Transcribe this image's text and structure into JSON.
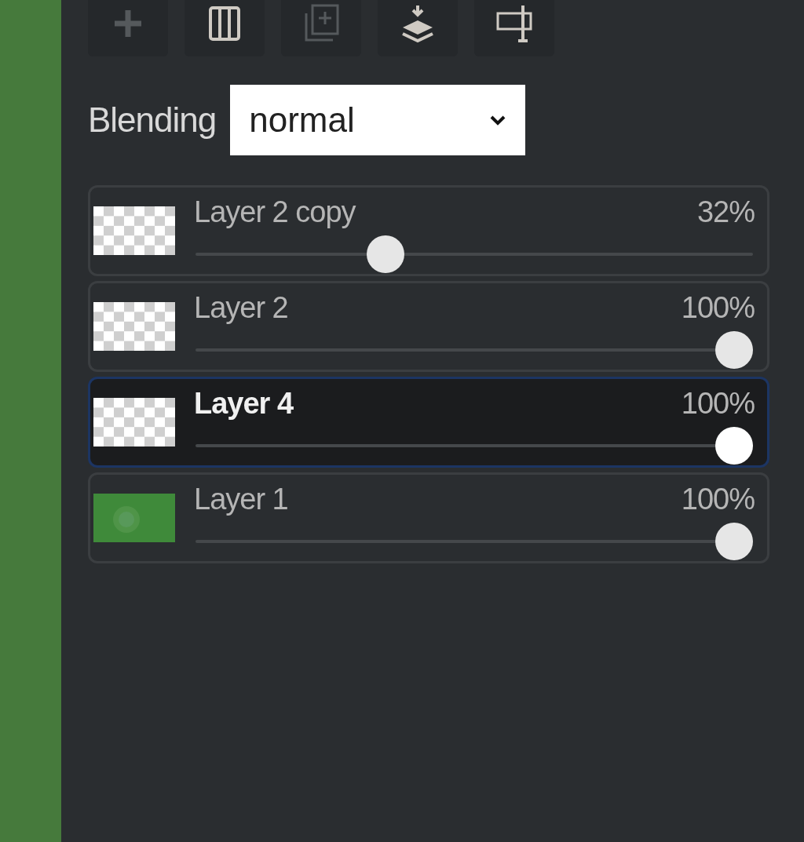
{
  "toolbar": [
    {
      "kind": "add",
      "disabled": true
    },
    {
      "kind": "columns",
      "disabled": false
    },
    {
      "kind": "duplicate",
      "disabled": true
    },
    {
      "kind": "merge",
      "disabled": false
    },
    {
      "kind": "resize",
      "disabled": false
    }
  ],
  "blending": {
    "label": "Blending",
    "value": "normal"
  },
  "layers": [
    {
      "name": "Layer 2 copy",
      "opacity": "32%",
      "level": 0.33,
      "selected": false,
      "kind": "transparent"
    },
    {
      "name": "Layer 2",
      "opacity": "100%",
      "level": 1,
      "selected": false,
      "kind": "transparent"
    },
    {
      "name": "Layer 4",
      "opacity": "100%",
      "level": 1,
      "selected": true,
      "kind": "transparent"
    },
    {
      "name": "Layer 1",
      "opacity": "100%",
      "level": 1,
      "selected": false,
      "kind": "green"
    }
  ]
}
